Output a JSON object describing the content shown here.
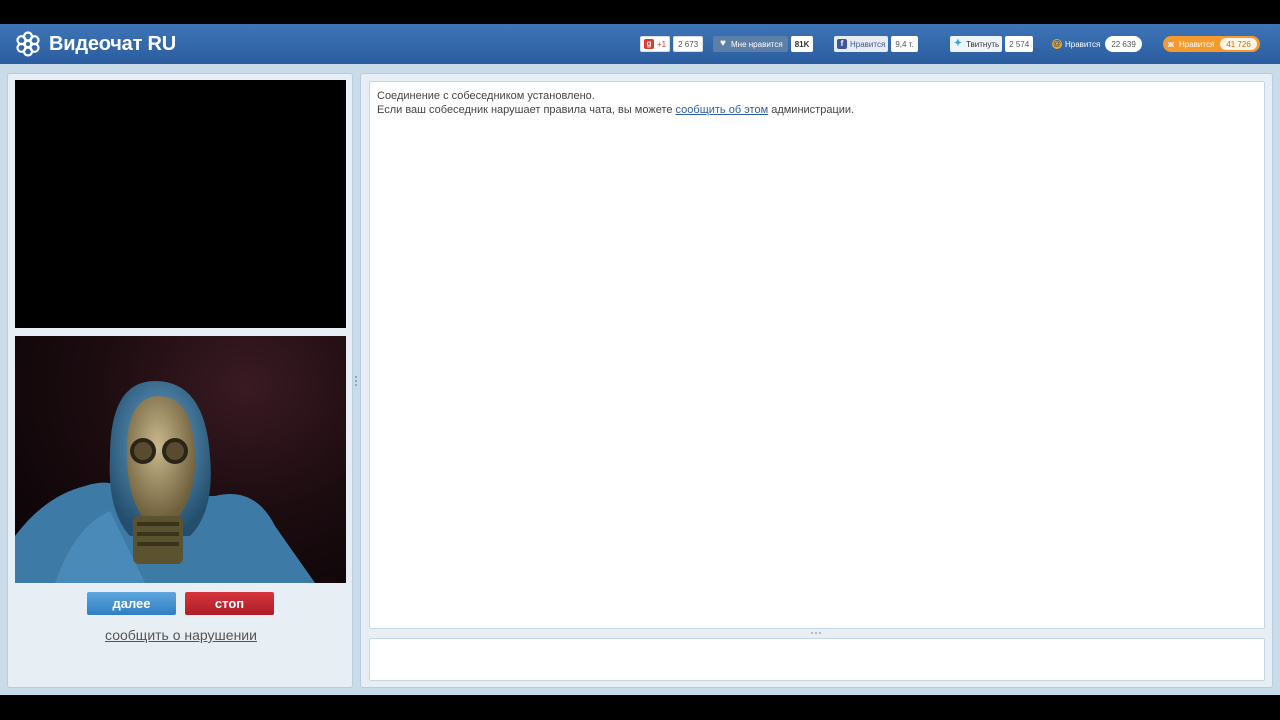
{
  "header": {
    "brand": "Видеочат RU",
    "share": {
      "gplus": {
        "label": "+1",
        "count": "2 673",
        "color": "#d73d32"
      },
      "vk": {
        "label": "Мне нравится",
        "count": "81K",
        "color": "#5b7fa6"
      },
      "facebook": {
        "label": "Нравится",
        "count": "9,4 т.",
        "color": "#3b5998"
      },
      "twitter": {
        "label": "Твитнуть",
        "count": "2 574",
        "color": "#2ea9e1"
      },
      "mailru": {
        "label": "Нравится",
        "count": "22 639",
        "color": "#168de2"
      },
      "odnoklassniki": {
        "label": "Нравится",
        "count": "41 726",
        "color": "#f59a2e"
      }
    }
  },
  "controls": {
    "next_label": "далее",
    "stop_label": "стоп",
    "report_label": "сообщить о нарушении"
  },
  "chat": {
    "line1": "Соединение с собеседником установлено.",
    "line2_before": "Если ваш собеседник нарушает правила чата, вы можете ",
    "line2_link": "сообщить об этом",
    "line2_after": " администрации.",
    "input_value": ""
  }
}
